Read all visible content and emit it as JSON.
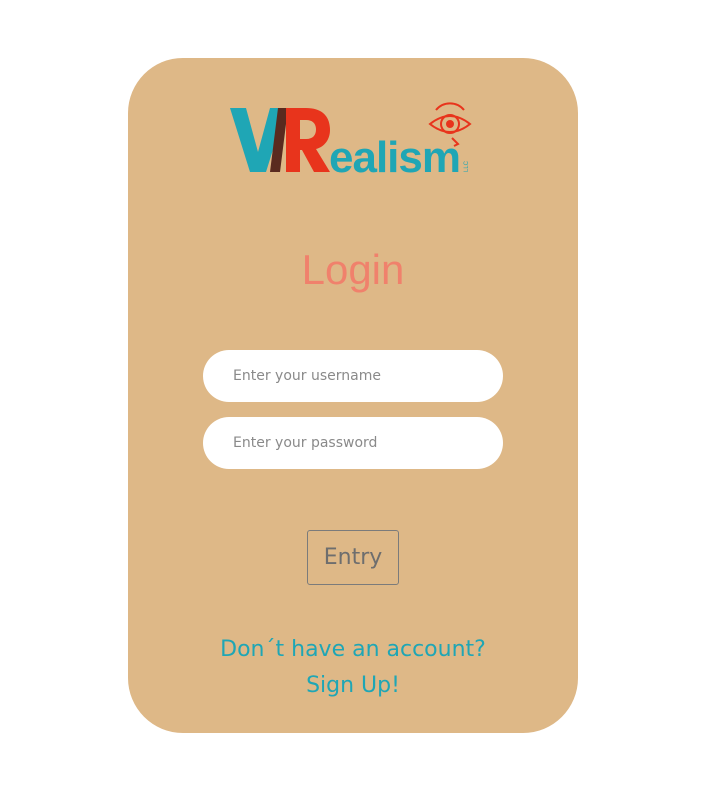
{
  "logo": {
    "brand_text": "VRealism",
    "sub_text": "LLC",
    "colors": {
      "teal": "#1fa6b5",
      "red": "#e8341c",
      "dark": "#5a2a1f"
    }
  },
  "login": {
    "title": "Login",
    "username_placeholder": "Enter your username",
    "password_placeholder": "Enter your password",
    "entry_label": "Entry"
  },
  "signup": {
    "question": "Don´t have an account?",
    "link_label": "Sign Up!"
  },
  "colors": {
    "card_background": "#deb887",
    "title": "#f0816c",
    "link": "#1fa6b5"
  }
}
